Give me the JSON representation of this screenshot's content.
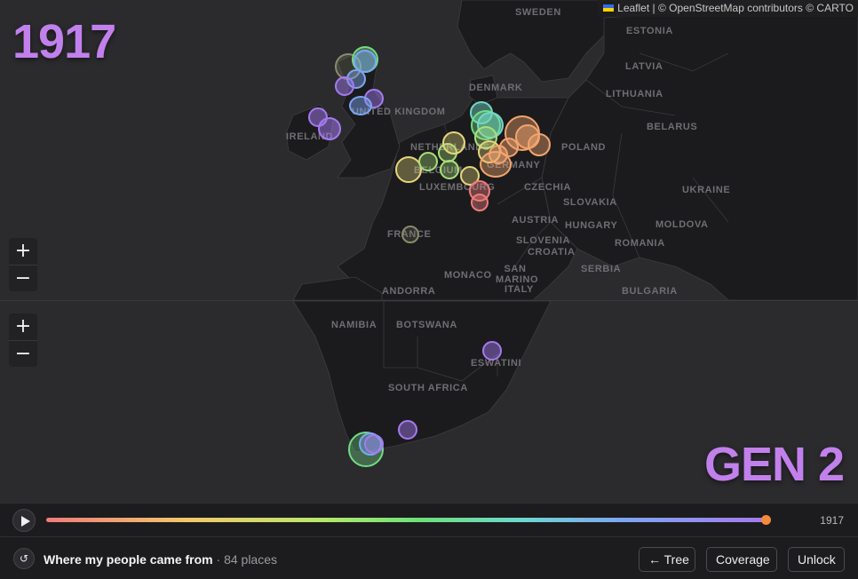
{
  "year_label": "1917",
  "gen_label": "GEN 2",
  "attribution": {
    "leaflet": "Leaflet",
    "separator": "|",
    "osm": "© OpenStreetMap contributors",
    "carto": "© CARTO"
  },
  "zoom": {
    "in_symbol": "+",
    "out_symbol": "−"
  },
  "timeline": {
    "year": "1917",
    "progress": 1.0
  },
  "footer": {
    "title": "Where my people came from",
    "separator": "·",
    "count": "84 places",
    "reset_icon": "↺",
    "tree_button": "← Tree",
    "coverage_button": "Coverage",
    "unlock_button": "Unlock"
  },
  "europe_labels": [
    "SWEDEN",
    "ESTONIA",
    "LATVIA",
    "DENMARK",
    "LITHUANIA",
    "BELARUS",
    "POLAND",
    "IRELAND",
    "UNITED KINGDOM",
    "NETHERLANDS",
    "BELGIUM",
    "LUXEMBOURG",
    "GERMANY",
    "CZECHIA",
    "SLOVAKIA",
    "UKRAINE",
    "AUSTRIA",
    "HUNGARY",
    "MOLDOVA",
    "ROMANIA",
    "SLOVENIA",
    "CROATIA",
    "SERBIA",
    "FRANCE",
    "MONACO",
    "SAN MARINO",
    "ITALY",
    "ANDORRA",
    "BULGARIA"
  ],
  "africa_labels": [
    "NAMIBIA",
    "BOTSWANA",
    "ESWATINI",
    "SOUTH AFRICA"
  ],
  "colors": {
    "accent": "#c280ec",
    "thumb": "#f58a3c",
    "red": "#f07b7b",
    "orange": "#f3a46e",
    "yellow": "#e6d77a",
    "lime": "#a9e07a",
    "green": "#72dc83",
    "teal": "#72d8c8",
    "blue": "#7da6f2",
    "purple": "#a57af0"
  }
}
